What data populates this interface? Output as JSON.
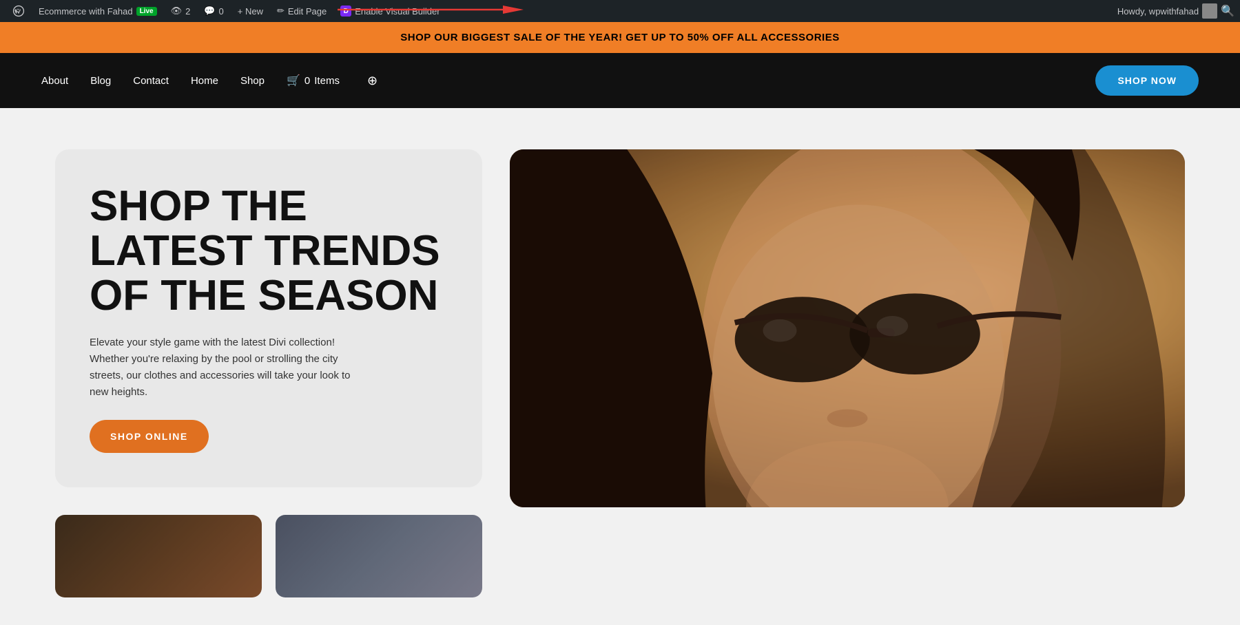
{
  "adminBar": {
    "siteName": "Ecommerce with Fahad",
    "liveBadge": "Live",
    "viewCount": "2",
    "commentCount": "0",
    "newLabel": "+ New",
    "editPageLabel": "Edit Page",
    "enableVisualBuilderLabel": "Enable Visual Builder",
    "howdyText": "Howdy, wpwithfahad"
  },
  "promoBanner": {
    "text": "SHOP OUR BIGGEST SALE OF THE YEAR! GET UP TO 50% OFF ALL ACCESSORIES"
  },
  "header": {
    "navLinks": [
      {
        "label": "About"
      },
      {
        "label": "Blog"
      },
      {
        "label": "Contact"
      },
      {
        "label": "Home"
      },
      {
        "label": "Shop"
      }
    ],
    "cartItemCount": "0",
    "cartLabel": "Items",
    "shopNowLabel": "SHOP NOW"
  },
  "hero": {
    "title": "SHOP THE LATEST TRENDS OF THE SEASON",
    "description": "Elevate your style game with the latest Divi collection! Whether you're relaxing by the pool or strolling the city streets, our clothes and accessories will take your look to new heights.",
    "shopOnlineLabel": "SHOP ONLINE"
  },
  "colors": {
    "adminBarBg": "#1d2327",
    "promoBg": "#f07e26",
    "headerBg": "#111111",
    "shopNowBg": "#1a8fd1",
    "shopOnlineBg": "#e07020",
    "liveBadgeBg": "#00a32a",
    "diviIconBg": "#7a2af5"
  }
}
